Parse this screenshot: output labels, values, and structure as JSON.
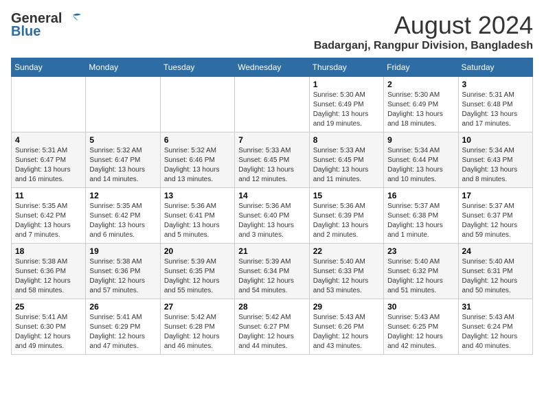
{
  "header": {
    "logo_line1": "General",
    "logo_line2": "Blue",
    "month_year": "August 2024",
    "location": "Badarganj, Rangpur Division, Bangladesh"
  },
  "days_of_week": [
    "Sunday",
    "Monday",
    "Tuesday",
    "Wednesday",
    "Thursday",
    "Friday",
    "Saturday"
  ],
  "weeks": [
    [
      {
        "day": "",
        "info": ""
      },
      {
        "day": "",
        "info": ""
      },
      {
        "day": "",
        "info": ""
      },
      {
        "day": "",
        "info": ""
      },
      {
        "day": "1",
        "info": "Sunrise: 5:30 AM\nSunset: 6:49 PM\nDaylight: 13 hours\nand 19 minutes."
      },
      {
        "day": "2",
        "info": "Sunrise: 5:30 AM\nSunset: 6:49 PM\nDaylight: 13 hours\nand 18 minutes."
      },
      {
        "day": "3",
        "info": "Sunrise: 5:31 AM\nSunset: 6:48 PM\nDaylight: 13 hours\nand 17 minutes."
      }
    ],
    [
      {
        "day": "4",
        "info": "Sunrise: 5:31 AM\nSunset: 6:47 PM\nDaylight: 13 hours\nand 16 minutes."
      },
      {
        "day": "5",
        "info": "Sunrise: 5:32 AM\nSunset: 6:47 PM\nDaylight: 13 hours\nand 14 minutes."
      },
      {
        "day": "6",
        "info": "Sunrise: 5:32 AM\nSunset: 6:46 PM\nDaylight: 13 hours\nand 13 minutes."
      },
      {
        "day": "7",
        "info": "Sunrise: 5:33 AM\nSunset: 6:45 PM\nDaylight: 13 hours\nand 12 minutes."
      },
      {
        "day": "8",
        "info": "Sunrise: 5:33 AM\nSunset: 6:45 PM\nDaylight: 13 hours\nand 11 minutes."
      },
      {
        "day": "9",
        "info": "Sunrise: 5:34 AM\nSunset: 6:44 PM\nDaylight: 13 hours\nand 10 minutes."
      },
      {
        "day": "10",
        "info": "Sunrise: 5:34 AM\nSunset: 6:43 PM\nDaylight: 13 hours\nand 8 minutes."
      }
    ],
    [
      {
        "day": "11",
        "info": "Sunrise: 5:35 AM\nSunset: 6:42 PM\nDaylight: 13 hours\nand 7 minutes."
      },
      {
        "day": "12",
        "info": "Sunrise: 5:35 AM\nSunset: 6:42 PM\nDaylight: 13 hours\nand 6 minutes."
      },
      {
        "day": "13",
        "info": "Sunrise: 5:36 AM\nSunset: 6:41 PM\nDaylight: 13 hours\nand 5 minutes."
      },
      {
        "day": "14",
        "info": "Sunrise: 5:36 AM\nSunset: 6:40 PM\nDaylight: 13 hours\nand 3 minutes."
      },
      {
        "day": "15",
        "info": "Sunrise: 5:36 AM\nSunset: 6:39 PM\nDaylight: 13 hours\nand 2 minutes."
      },
      {
        "day": "16",
        "info": "Sunrise: 5:37 AM\nSunset: 6:38 PM\nDaylight: 13 hours\nand 1 minute."
      },
      {
        "day": "17",
        "info": "Sunrise: 5:37 AM\nSunset: 6:37 PM\nDaylight: 12 hours\nand 59 minutes."
      }
    ],
    [
      {
        "day": "18",
        "info": "Sunrise: 5:38 AM\nSunset: 6:36 PM\nDaylight: 12 hours\nand 58 minutes."
      },
      {
        "day": "19",
        "info": "Sunrise: 5:38 AM\nSunset: 6:36 PM\nDaylight: 12 hours\nand 57 minutes."
      },
      {
        "day": "20",
        "info": "Sunrise: 5:39 AM\nSunset: 6:35 PM\nDaylight: 12 hours\nand 55 minutes."
      },
      {
        "day": "21",
        "info": "Sunrise: 5:39 AM\nSunset: 6:34 PM\nDaylight: 12 hours\nand 54 minutes."
      },
      {
        "day": "22",
        "info": "Sunrise: 5:40 AM\nSunset: 6:33 PM\nDaylight: 12 hours\nand 53 minutes."
      },
      {
        "day": "23",
        "info": "Sunrise: 5:40 AM\nSunset: 6:32 PM\nDaylight: 12 hours\nand 51 minutes."
      },
      {
        "day": "24",
        "info": "Sunrise: 5:40 AM\nSunset: 6:31 PM\nDaylight: 12 hours\nand 50 minutes."
      }
    ],
    [
      {
        "day": "25",
        "info": "Sunrise: 5:41 AM\nSunset: 6:30 PM\nDaylight: 12 hours\nand 49 minutes."
      },
      {
        "day": "26",
        "info": "Sunrise: 5:41 AM\nSunset: 6:29 PM\nDaylight: 12 hours\nand 47 minutes."
      },
      {
        "day": "27",
        "info": "Sunrise: 5:42 AM\nSunset: 6:28 PM\nDaylight: 12 hours\nand 46 minutes."
      },
      {
        "day": "28",
        "info": "Sunrise: 5:42 AM\nSunset: 6:27 PM\nDaylight: 12 hours\nand 44 minutes."
      },
      {
        "day": "29",
        "info": "Sunrise: 5:43 AM\nSunset: 6:26 PM\nDaylight: 12 hours\nand 43 minutes."
      },
      {
        "day": "30",
        "info": "Sunrise: 5:43 AM\nSunset: 6:25 PM\nDaylight: 12 hours\nand 42 minutes."
      },
      {
        "day": "31",
        "info": "Sunrise: 5:43 AM\nSunset: 6:24 PM\nDaylight: 12 hours\nand 40 minutes."
      }
    ]
  ]
}
